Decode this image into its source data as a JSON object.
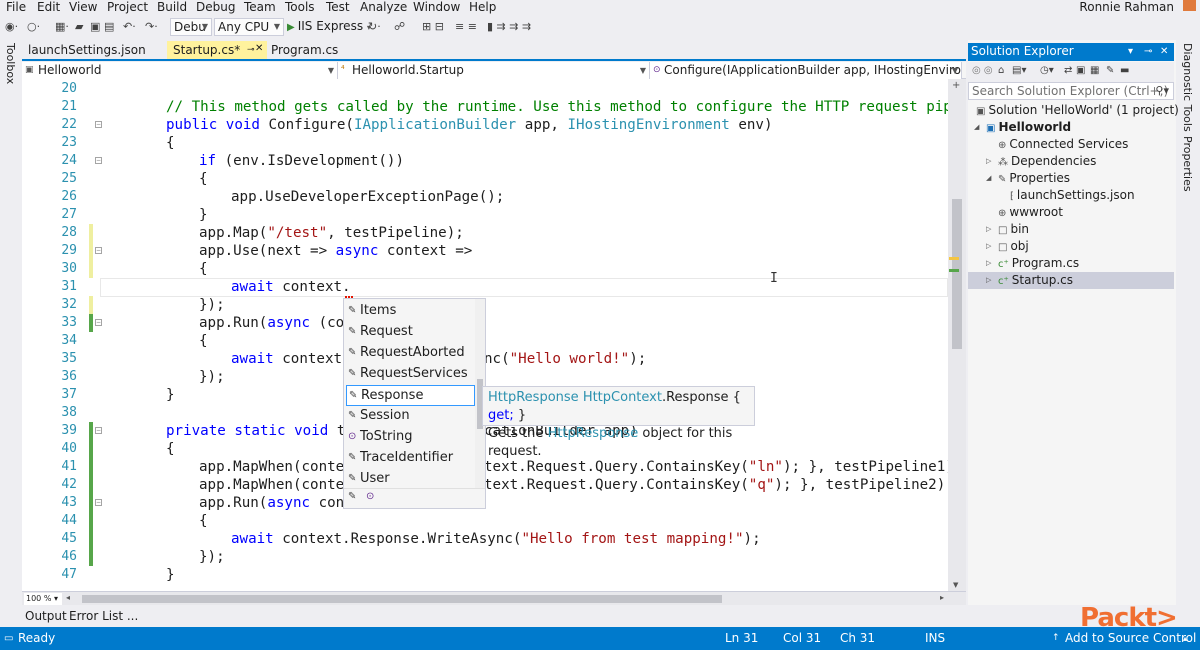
{
  "menubar": {
    "items": [
      "File",
      "Edit",
      "View",
      "Project",
      "Build",
      "Debug",
      "Team",
      "Tools",
      "Test",
      "Analyze",
      "Window",
      "Help"
    ],
    "user_name": "Ronnie Rahman"
  },
  "toolbar": {
    "config": "Debu",
    "platform": "Any CPU",
    "run_target": "IIS Express"
  },
  "side": {
    "toolbox": "Toolbox",
    "diagnostic_tools": "Diagnostic Tools",
    "properties": "Properties"
  },
  "doc_tabs": [
    {
      "label": "launchSettings.json",
      "active": false
    },
    {
      "label": "Startup.cs*",
      "active": true
    },
    {
      "label": "Program.cs",
      "active": false
    }
  ],
  "navbar": {
    "project": "Helloworld",
    "class": "Helloworld.Startup",
    "member": "Configure(IApplicationBuilder app, IHostingEnvironmer"
  },
  "editor": {
    "line_numbers": [
      "20",
      "21",
      "22",
      "23",
      "24",
      "25",
      "26",
      "27",
      "28",
      "29",
      "30",
      "31",
      "32",
      "33",
      "34",
      "35",
      "36",
      "37",
      "38",
      "39",
      "40",
      "41",
      "42",
      "43",
      "44",
      "45",
      "46",
      "47"
    ],
    "zoom": "100 %"
  },
  "completion": {
    "items": [
      "Items",
      "Request",
      "RequestAborted",
      "RequestServices",
      "Response",
      "Session",
      "ToString",
      "TraceIdentifier",
      "User"
    ],
    "selected": "Response"
  },
  "quick_info": {
    "sig_type": "HttpResponse",
    "sig_owner": "HttpContext",
    "sig_member": ".Response {",
    "sig_get": "get;",
    "sig_end": "}",
    "desc_prefix": "Gets the",
    "desc_type": "HttpResponse",
    "desc_suffix": "object for this request."
  },
  "solution_explorer": {
    "title": "Solution Explorer",
    "search_placeholder": "Search Solution Explorer (Ctrl+;)",
    "tree": {
      "solution": "Solution 'HelloWorld' (1 project)",
      "project": "Helloworld",
      "connected": "Connected Services",
      "dependencies": "Dependencies",
      "properties": "Properties",
      "launch": "launchSettings.json",
      "wwwroot": "wwwroot",
      "bin": "bin",
      "obj": "obj",
      "program": "Program.cs",
      "startup": "Startup.cs"
    }
  },
  "bottom_tabs": [
    "Output",
    "Error List ..."
  ],
  "status": {
    "state": "Ready",
    "ln": "Ln 31",
    "col": "Col 31",
    "ch": "Ch 31",
    "mode": "INS",
    "source_control": "Add to Source Control"
  },
  "watermark": "Packt>"
}
